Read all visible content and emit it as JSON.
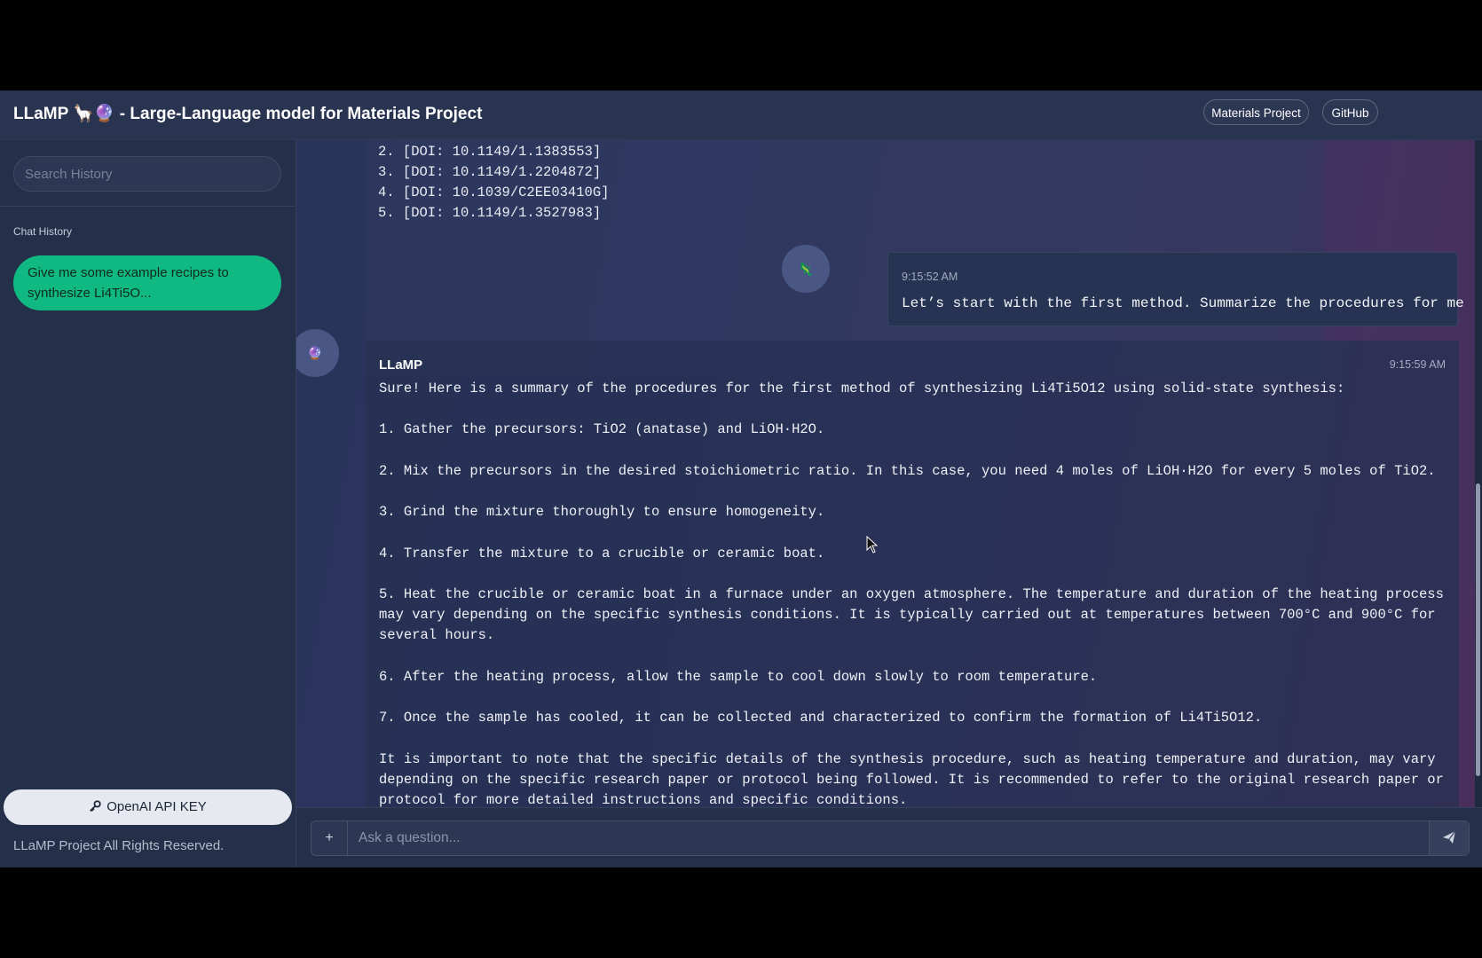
{
  "header": {
    "title": "LLaMP 🦙🔮 - Large-Language model for Materials Project",
    "buttons": [
      {
        "label": "Materials Project"
      },
      {
        "label": "GitHub"
      }
    ]
  },
  "sidebar": {
    "search_placeholder": "Search History",
    "section_label": "Chat History",
    "history": [
      {
        "label": "Give me some example recipes to synthesize Li4Ti5O..."
      }
    ],
    "api_key_button": "OpenAI API KEY",
    "footer": "LLaMP Project All Rights Reserved."
  },
  "chat": {
    "previous_lines": "2. [DOI: 10.1149/1.1383553]\n3. [DOI: 10.1149/1.2204872]\n4. [DOI: 10.1039/C2EE03410G]\n5. [DOI: 10.1149/1.3527983]",
    "user_message": {
      "avatar": "🦎",
      "time": "9:15:52 AM",
      "text": "Let’s start with the first method. Summarize the procedures for me"
    },
    "bot_message": {
      "avatar": "🔮",
      "name": "LLaMP",
      "time": "9:15:59 AM",
      "text": "Sure! Here is a summary of the procedures for the first method of synthesizing Li4Ti5O12 using solid-state synthesis:\n\n1. Gather the precursors: TiO2 (anatase) and LiOH·H2O.\n\n2. Mix the precursors in the desired stoichiometric ratio. In this case, you need 4 moles of LiOH·H2O for every 5 moles of TiO2.\n\n3. Grind the mixture thoroughly to ensure homogeneity.\n\n4. Transfer the mixture to a crucible or ceramic boat.\n\n5. Heat the crucible or ceramic boat in a furnace under an oxygen atmosphere. The temperature and duration of the heating process may vary depending on the specific synthesis conditions. It is typically carried out at temperatures between 700°C and 900°C for several hours.\n\n6. After the heating process, allow the sample to cool down slowly to room temperature.\n\n7. Once the sample has cooled, it can be collected and characterized to confirm the formation of Li4Ti5O12.\n\nIt is important to note that the specific details of the synthesis procedure, such as heating temperature and duration, may vary depending on the specific research paper or protocol being followed. It is recommended to refer to the original research paper or protocol for more detailed instructions and specific conditions."
    }
  },
  "input": {
    "plus_label": "+",
    "placeholder": "Ask a question..."
  },
  "colors": {
    "accent_green": "#10b981",
    "background": "#253049"
  }
}
